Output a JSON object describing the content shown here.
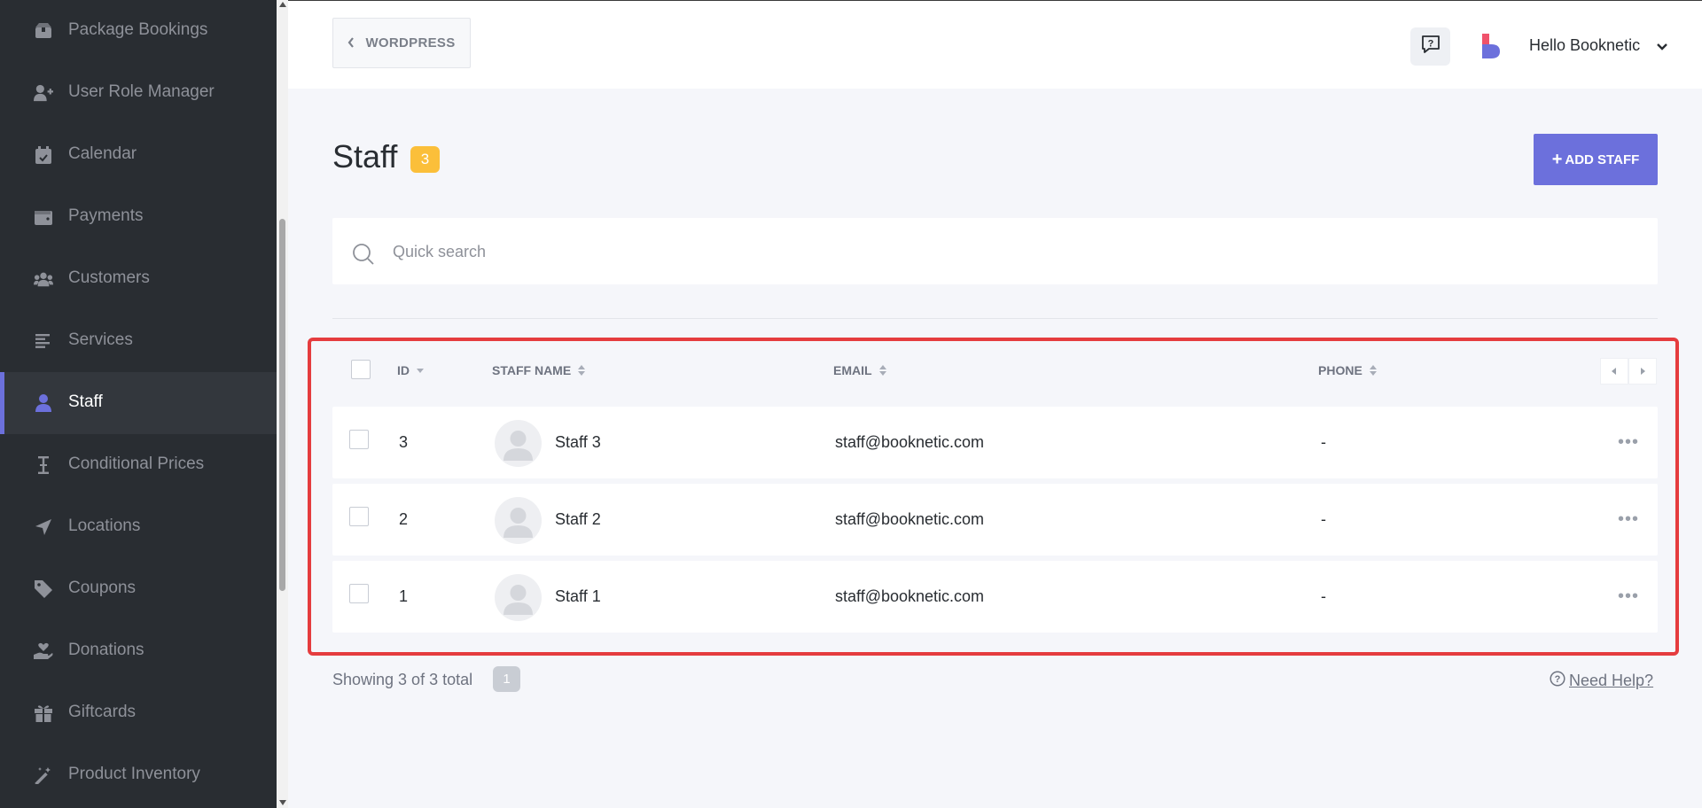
{
  "sidebar": {
    "items": [
      {
        "label": "Package Bookings",
        "icon": "package-icon"
      },
      {
        "label": "User Role Manager",
        "icon": "user-plus-icon"
      },
      {
        "label": "Calendar",
        "icon": "calendar-icon"
      },
      {
        "label": "Payments",
        "icon": "wallet-icon"
      },
      {
        "label": "Customers",
        "icon": "users-icon"
      },
      {
        "label": "Services",
        "icon": "list-icon"
      },
      {
        "label": "Staff",
        "icon": "user-icon",
        "active": true
      },
      {
        "label": "Conditional Prices",
        "icon": "i-beam-icon"
      },
      {
        "label": "Locations",
        "icon": "location-arrow-icon"
      },
      {
        "label": "Coupons",
        "icon": "tag-icon"
      },
      {
        "label": "Donations",
        "icon": "hand-holding-heart-icon"
      },
      {
        "label": "Giftcards",
        "icon": "gift-icon"
      },
      {
        "label": "Product Inventory",
        "icon": "magic-wand-icon"
      }
    ]
  },
  "header": {
    "wordpress_label": "WORDPRESS",
    "greeting": "Hello Booknetic"
  },
  "page": {
    "title": "Staff",
    "count": "3",
    "add_button": "ADD STAFF",
    "search_placeholder": "Quick search"
  },
  "table": {
    "columns": {
      "id": "ID",
      "name": "STAFF NAME",
      "email": "EMAIL",
      "phone": "PHONE"
    },
    "rows": [
      {
        "id": "3",
        "name": "Staff 3",
        "email": "staff@booknetic.com",
        "phone": "-"
      },
      {
        "id": "2",
        "name": "Staff 2",
        "email": "staff@booknetic.com",
        "phone": "-"
      },
      {
        "id": "1",
        "name": "Staff 1",
        "email": "staff@booknetic.com",
        "phone": "-"
      }
    ]
  },
  "footer": {
    "showing": "Showing 3 of 3 total",
    "page": "1",
    "need_help": "Need Help?"
  },
  "colors": {
    "accent": "#6c70dc",
    "sidebar_bg": "#292d32",
    "badge": "#fbbf3a",
    "highlight_border": "#e53c3e"
  }
}
